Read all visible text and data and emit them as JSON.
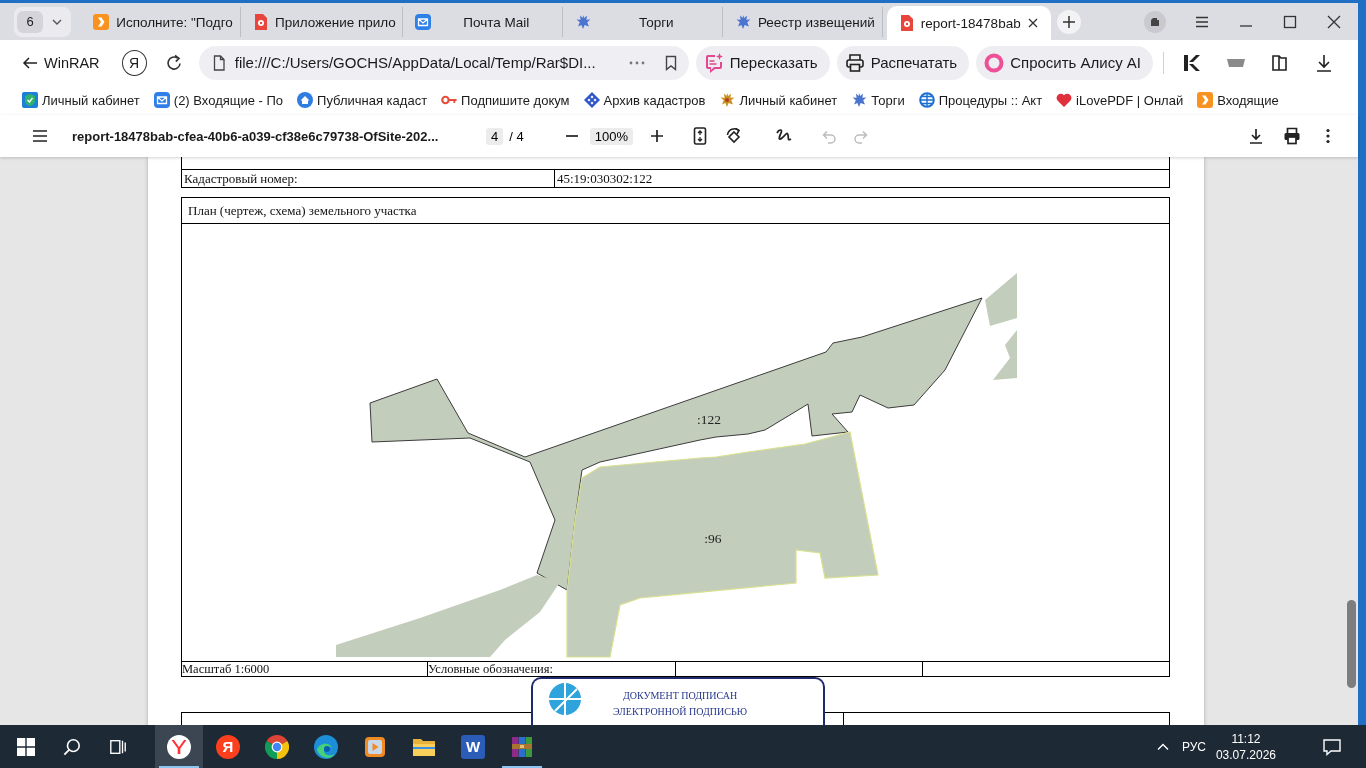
{
  "tab_strip": {
    "tab_count": "6",
    "tabs": [
      {
        "title": "Исполните: \"Подго",
        "selected": false
      },
      {
        "title": "Приложение прило",
        "selected": false
      },
      {
        "title": "Почта Mail",
        "selected": false
      },
      {
        "title": "Торги",
        "selected": false
      },
      {
        "title": "Реестр извещений",
        "selected": false
      },
      {
        "title": "report-18478bab",
        "selected": true
      }
    ]
  },
  "address_bar": {
    "back_label": "WinRAR",
    "logo_button": "Я",
    "url": "file:///C:/Users/GOCHS/AppData/Local/Temp/Rar$DI...",
    "actions": [
      "Пересказать",
      "Распечатать",
      "Спросить Алису AI"
    ]
  },
  "bookmarks": [
    "Личный кабинет",
    "(2) Входящие - По",
    "Публичная кадаст",
    "Подпишите докум",
    "Архив кадастров",
    "Личный кабинет",
    "Торги",
    "Процедуры :: Акт",
    "iLovePDF | Онлай",
    "Входящие"
  ],
  "pdf_toolbar": {
    "title": "report-18478bab-cfea-40b6-a039-cf38e6c79738-OfSite-202...",
    "page": "4",
    "page_of": "/ 4",
    "zoom": "100%",
    "undo_disabled": true,
    "redo_disabled": true
  },
  "document": {
    "fields": [
      {
        "label": "Кадастровый номер:",
        "value": "45:19:030302:122"
      }
    ],
    "plan_title": "План (чертеж, схема) земельного участка",
    "parcel_labels": [
      ":122",
      ":96"
    ],
    "scale": "Масштаб 1:6000",
    "legend_label": "Условные обозначения:",
    "stamp_lines": [
      "ДОКУМЕНТ ПОДПИСАН",
      "ЭЛЕКТРОННОЙ ПОДПИСЬЮ"
    ]
  },
  "taskbar": {
    "apps": [
      {
        "selected": true,
        "running": true
      },
      {
        "glyph": "Я",
        "selected": false,
        "running": false
      },
      {
        "selected": false,
        "running": false
      },
      {
        "selected": false,
        "running": false
      },
      {
        "selected": false,
        "running": false
      },
      {
        "selected": false,
        "running": false
      },
      {
        "glyph": "W",
        "selected": false,
        "running": false
      },
      {
        "selected": false,
        "running": true
      }
    ],
    "language": "РУС",
    "time": "11:12",
    "date": "03.07.2026"
  }
}
